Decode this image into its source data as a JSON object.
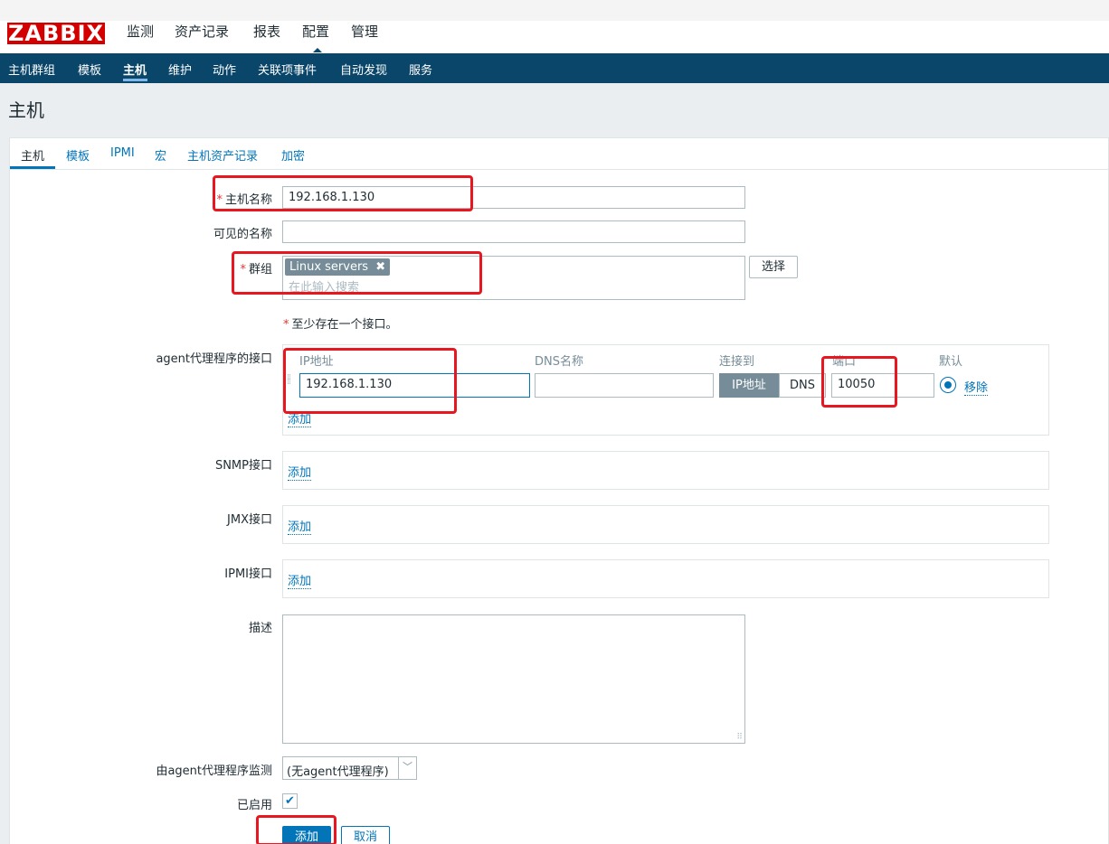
{
  "logo": "ZABBIX",
  "top_nav": [
    "监测",
    "资产记录",
    "报表",
    "配置",
    "管理"
  ],
  "sub_nav": [
    "主机群组",
    "模板",
    "主机",
    "维护",
    "动作",
    "关联项事件",
    "自动发现",
    "服务"
  ],
  "page_title": "主机",
  "tabs": [
    "主机",
    "模板",
    "IPMI",
    "宏",
    "主机资产记录",
    "加密"
  ],
  "form": {
    "host_name_label": "主机名称",
    "host_name_value": "192.168.1.130",
    "visible_name_label": "可见的名称",
    "visible_name_value": "",
    "groups_label": "群组",
    "group_tag": "Linux servers",
    "groups_placeholder": "在此输入搜索",
    "select_button": "选择",
    "interface_note": "至少存在一个接口。",
    "agent_label": "agent代理程序的接口",
    "col_ip": "IP地址",
    "col_dns": "DNS名称",
    "col_connect": "连接到",
    "col_port": "端口",
    "col_default": "默认",
    "agent_ip": "192.168.1.130",
    "agent_dns": "",
    "connect_ip": "IP地址",
    "connect_dns": "DNS",
    "agent_port": "10050",
    "remove_link": "移除",
    "add_link": "添加",
    "snmp_label": "SNMP接口",
    "jmx_label": "JMX接口",
    "ipmi_label": "IPMI接口",
    "description_label": "描述",
    "description_value": "",
    "proxy_label": "由agent代理程序监测",
    "proxy_value": "(无agent代理程序)",
    "enabled_label": "已启用",
    "enabled": true,
    "add_button": "添加",
    "cancel_button": "取消"
  },
  "colors": {
    "brand": "#d40000",
    "nav": "#0a466a",
    "link": "#0275b8",
    "annotation": "#e8171f"
  }
}
